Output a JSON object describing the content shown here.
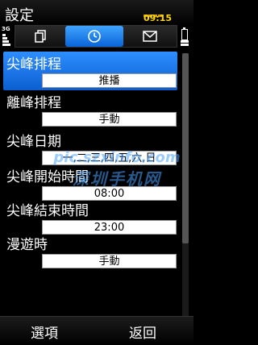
{
  "title": "設定",
  "time": "09:15",
  "network": "3G",
  "tabs": [
    {
      "icon": "documents-icon",
      "active": false
    },
    {
      "icon": "clock-icon",
      "active": true
    },
    {
      "icon": "envelope-icon",
      "active": false
    }
  ],
  "settings": [
    {
      "label": "尖峰排程",
      "value": "推播",
      "selected": true
    },
    {
      "label": "離峰排程",
      "value": "手動",
      "selected": false
    },
    {
      "label": "尖峰日期",
      "value": "一,二,三,四,五,六,日",
      "selected": false
    },
    {
      "label": "尖峰開始時間",
      "value": "08:00",
      "selected": false
    },
    {
      "label": "尖峰結束時間",
      "value": "23:00",
      "selected": false
    },
    {
      "label": "漫遊時",
      "value": "手動",
      "selected": false
    }
  ],
  "watermark": {
    "line1": "pic.szxinfo.com",
    "line2": "深圳手机网"
  },
  "softkeys": {
    "left": "選項",
    "right": "返回"
  },
  "colors": {
    "highlight": "#1f7ff0",
    "time": "#ffd800"
  }
}
